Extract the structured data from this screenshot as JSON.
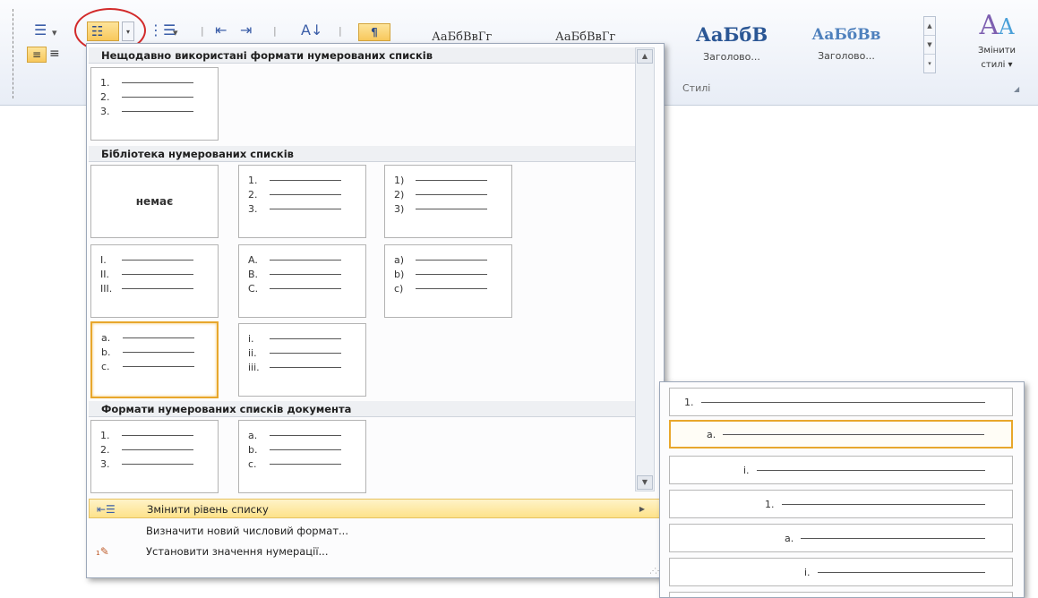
{
  "ribbon": {
    "bullets_icon": "bullets-icon",
    "numbering_icon": "numbering-icon",
    "multilevel_icon": "multilevel-list-icon",
    "decrease_indent_icon": "decrease-indent-icon",
    "increase_indent_icon": "increase-indent-icon",
    "sort_icon": "sort-icon",
    "pilcrow": "¶",
    "styles": [
      {
        "sample": "АаБбВвГг",
        "label": ""
      },
      {
        "sample": "АаБбВвГг",
        "label": ""
      },
      {
        "sample": "АаБбВ",
        "label": "Заголово..."
      },
      {
        "sample": "АаБбВв",
        "label": "Заголово..."
      }
    ],
    "styles_group_label": "Стилі",
    "change_styles_line1": "Змінити",
    "change_styles_line2": "стилі ▾",
    "change_styles_glyph": "A"
  },
  "dropdown": {
    "recent_header": "Нещодавно використані формати нумерованих списків",
    "recent_tiles": [
      {
        "rows": [
          "1.",
          "2.",
          "3."
        ]
      }
    ],
    "library_header": "Бібліотека нумерованих списків",
    "none_label": "немає",
    "library_tiles": [
      {
        "rows": [
          "1.",
          "2.",
          "3."
        ]
      },
      {
        "rows": [
          "1)",
          "2)",
          "3)"
        ]
      },
      {
        "rows": [
          "I.",
          "II.",
          "III."
        ]
      },
      {
        "rows": [
          "A.",
          "B.",
          "C."
        ]
      },
      {
        "rows": [
          "a)",
          "b)",
          "c)"
        ]
      },
      {
        "rows": [
          "a.",
          "b.",
          "c."
        ]
      },
      {
        "rows": [
          "i.",
          "ii.",
          "iii."
        ]
      }
    ],
    "document_header": "Формати нумерованих списків документа",
    "document_tiles": [
      {
        "rows": [
          "1.",
          "2.",
          "3."
        ]
      },
      {
        "rows": [
          "a.",
          "b.",
          "c."
        ]
      }
    ],
    "menu": {
      "change_level": "Змінити рівень списку",
      "define_new": "Визначити новий числовий формат...",
      "set_value": "Установити значення нумерації..."
    }
  },
  "submenu": {
    "levels": [
      "1.",
      "a.",
      "i.",
      "1.",
      "a.",
      "i.",
      ""
    ]
  }
}
